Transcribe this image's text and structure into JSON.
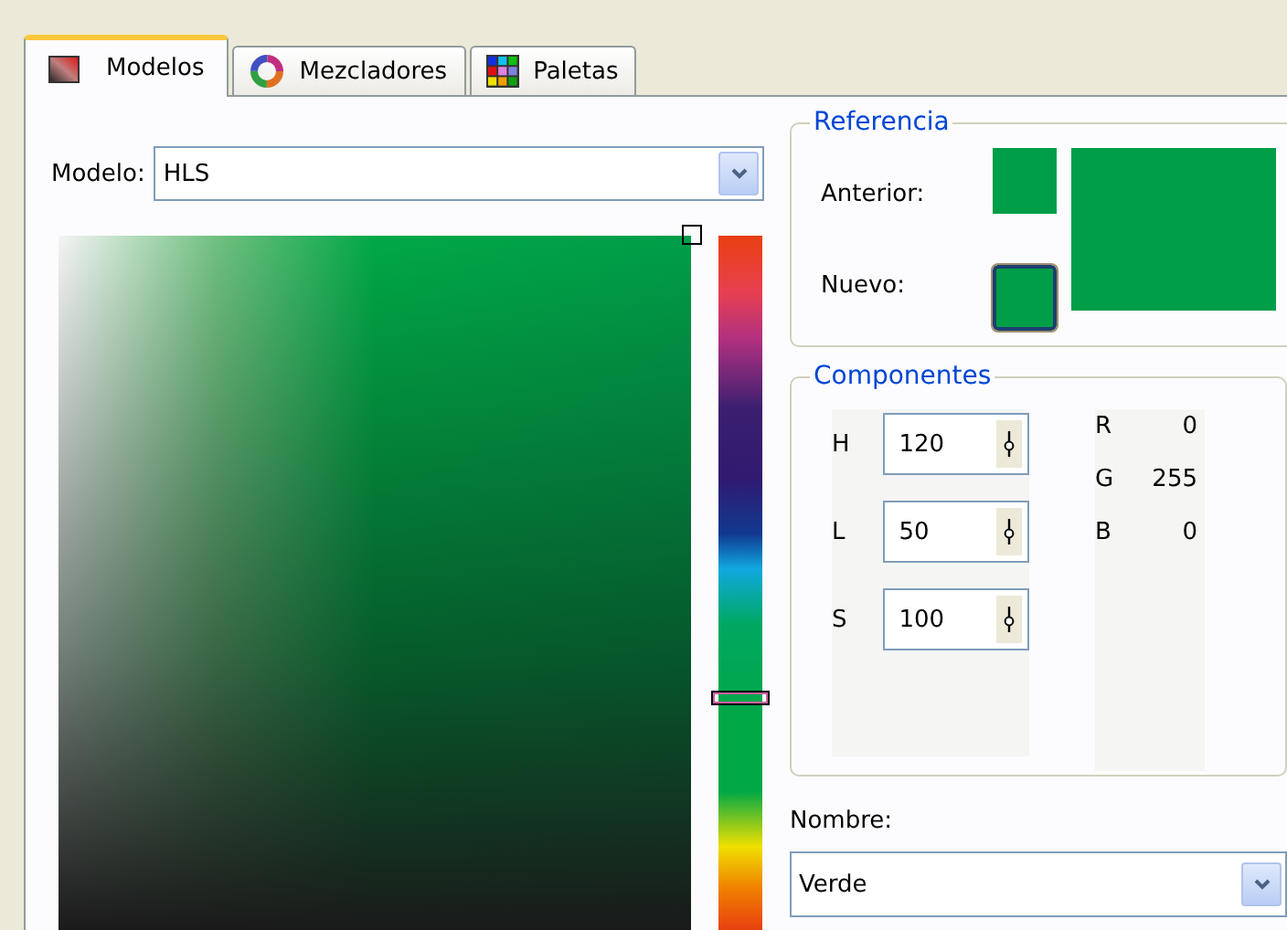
{
  "tabs": [
    {
      "label": "Modelos",
      "selected": true
    },
    {
      "label": "Mezcladores",
      "selected": false
    },
    {
      "label": "Paletas",
      "selected": false
    }
  ],
  "model": {
    "label": "Modelo:",
    "value": "HLS"
  },
  "hue_slider": {
    "level": 0.333
  },
  "reference": {
    "title": "Referencia",
    "swatches": [
      {
        "label": "Anterior:",
        "color": "#009e49",
        "selected": false
      },
      {
        "label": "Nuevo:",
        "color": "#009e49",
        "selected": true
      }
    ]
  },
  "components": {
    "title": "Componentes",
    "fields": [
      {
        "label": "H",
        "value": "120"
      },
      {
        "label": "L",
        "value": "50"
      },
      {
        "label": "S",
        "value": "100"
      }
    ],
    "rgb": [
      {
        "label": "R",
        "value": "0"
      },
      {
        "label": "G",
        "value": "255"
      },
      {
        "label": "B",
        "value": "0"
      }
    ]
  },
  "name": {
    "label": "Nombre:",
    "value": "Verde"
  }
}
